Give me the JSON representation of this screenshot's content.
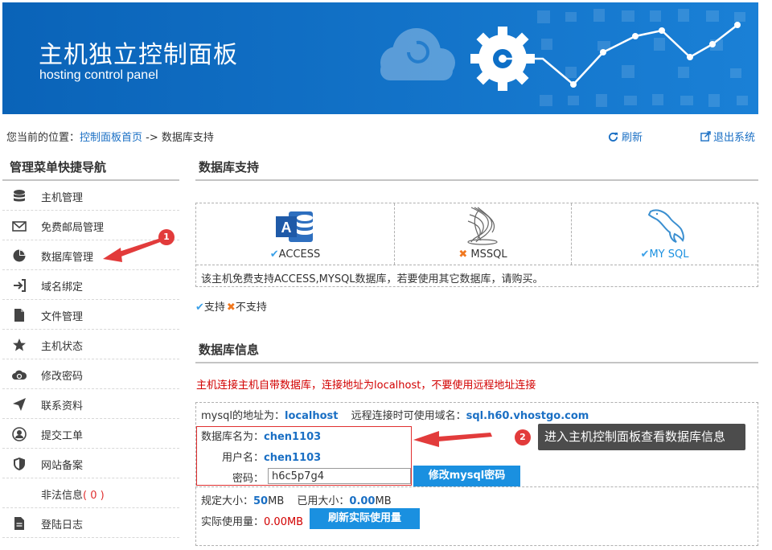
{
  "banner": {
    "title_cn": "主机独立控制面板",
    "title_en": "hosting control panel",
    "bg_color": "#0d6fc7"
  },
  "location": {
    "prefix": "您当前的位置：",
    "home_link": "控制面板首页",
    "separator": " -> ",
    "current": "数据库支持",
    "refresh": "刷新",
    "logout": "退出系统"
  },
  "sidebar": {
    "title": "管理菜单快捷导航",
    "items": [
      {
        "label": "主机管理",
        "icon": "database-icon"
      },
      {
        "label": "免费邮局管理",
        "icon": "mail-icon"
      },
      {
        "label": "数据库管理",
        "icon": "pie-chart-icon"
      },
      {
        "label": "域名绑定",
        "icon": "login-arrow-icon"
      },
      {
        "label": "文件管理",
        "icon": "file-icon"
      },
      {
        "label": "主机状态",
        "icon": "star-icon"
      },
      {
        "label": "修改密码",
        "icon": "cloud-refresh-icon"
      },
      {
        "label": "联系资料",
        "icon": "send-icon"
      },
      {
        "label": "提交工单",
        "icon": "user-icon"
      },
      {
        "label": "网站备案",
        "icon": "shield-icon"
      },
      {
        "label": "非法信息",
        "count": "( 0 )",
        "icon": ""
      },
      {
        "label": "登陆日志",
        "icon": "document-icon"
      }
    ]
  },
  "db_support": {
    "title": "数据库支持",
    "databases": [
      {
        "name": "ACCESS",
        "status": "supported",
        "icon": "access-icon"
      },
      {
        "name": "MSSQL",
        "status": "unsupported",
        "icon": "mssql-icon"
      },
      {
        "name": "MY SQL",
        "status": "supported",
        "icon": "mysql-dolphin-icon"
      }
    ],
    "note": "该主机免费支持ACCESS,MYSQL数据库，若要使用其它数据库，请购买。",
    "legend_supported": "支持",
    "legend_unsupported": "不支持"
  },
  "db_info": {
    "title": "数据库信息",
    "warning": "主机连接主机自带数据库，连接地址为localhost，不要使用远程地址连接",
    "mysql_addr_label": "mysql的地址为：",
    "mysql_addr": "localhost",
    "remote_label": "远程连接时可使用域名：",
    "remote_domain": "sql.h60.vhostgo.com",
    "dbname_label": "数据库名为：",
    "dbname": "chen1103",
    "username_label": "用户名：",
    "username": "chen1103",
    "password_label": "密码：",
    "password": "h6c5p7g4",
    "change_pwd_btn": "修改mysql密码",
    "quota_label": "规定大小：",
    "quota_value": "50",
    "quota_unit": "MB",
    "used_label": "已用大小：",
    "used_value": "0.00",
    "used_unit": "MB",
    "actual_label": "实际使用量：",
    "actual_value": "0.00MB",
    "refresh_usage_btn": "刷新实际使用量"
  },
  "annotations": {
    "badge1": "1",
    "badge2": "2",
    "tip2": "进入主机控制面板查看数据库信息"
  },
  "colors": {
    "link": "#1a6fc4",
    "button": "#1a90e0",
    "warning": "#d20000",
    "annotation": "#e23b3b"
  }
}
